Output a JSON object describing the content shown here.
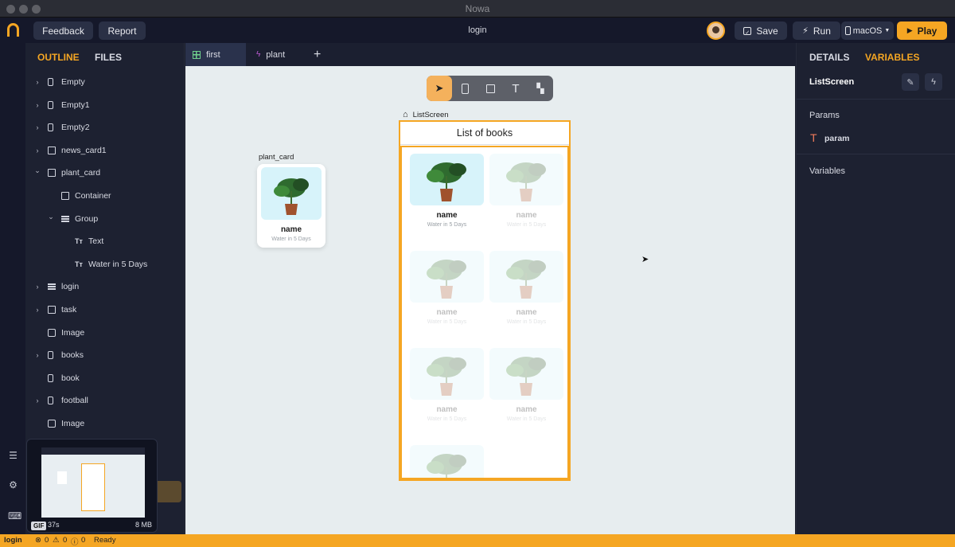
{
  "window": {
    "title": "Nowa"
  },
  "toolbar": {
    "feedback": "Feedback",
    "report": "Report",
    "center_title": "login",
    "save": "Save",
    "run": "Run",
    "platform": "macOS",
    "play": "Play"
  },
  "left_panel": {
    "tabs": [
      "OUTLINE",
      "FILES"
    ],
    "items": [
      {
        "label": "Empty",
        "icon": "phone-icon",
        "chevron": "right",
        "depth": 0
      },
      {
        "label": "Empty1",
        "icon": "phone-icon",
        "chevron": "right",
        "depth": 0
      },
      {
        "label": "Empty2",
        "icon": "phone-icon",
        "chevron": "right",
        "depth": 0
      },
      {
        "label": "news_card1",
        "icon": "box-icon",
        "chevron": "right",
        "depth": 0
      },
      {
        "label": "plant_card",
        "icon": "box-icon",
        "chevron": "down",
        "depth": 0
      },
      {
        "label": "Container",
        "icon": "box-icon",
        "chevron": "",
        "depth": 1
      },
      {
        "label": "Group",
        "icon": "list-icon",
        "chevron": "down",
        "depth": 1
      },
      {
        "label": "Text",
        "icon": "text-icon",
        "chevron": "",
        "depth": 2
      },
      {
        "label": "Water in 5 Days",
        "icon": "text-icon",
        "chevron": "",
        "depth": 2
      },
      {
        "label": "login",
        "icon": "list-icon",
        "chevron": "right",
        "depth": 0
      },
      {
        "label": "task",
        "icon": "box-icon",
        "chevron": "right",
        "depth": 0
      },
      {
        "label": "Image",
        "icon": "image-icon",
        "chevron": "",
        "depth": 0
      },
      {
        "label": "books",
        "icon": "phone-icon",
        "chevron": "right",
        "depth": 0
      },
      {
        "label": "book",
        "icon": "phone-icon",
        "chevron": "",
        "depth": 0
      },
      {
        "label": "football",
        "icon": "phone-icon",
        "chevron": "right",
        "depth": 0
      },
      {
        "label": "Image",
        "icon": "image-icon",
        "chevron": "",
        "depth": 0
      }
    ],
    "gif": {
      "badge": "GIF",
      "duration": "37s",
      "size": "8 MB"
    }
  },
  "editor_tabs": [
    {
      "label": "first",
      "icon": "grid-icon",
      "active": true
    },
    {
      "label": "plant",
      "icon": "bolt-icon",
      "active": false
    }
  ],
  "canvas": {
    "plant_card_label": "plant_card",
    "screen_label": "ListScreen",
    "app_title": "List of books",
    "card_name": "name",
    "card_subtitle": "Water in 5 Days"
  },
  "right_panel": {
    "tabs": [
      "DETAILS",
      "VARIABLES"
    ],
    "screen_name": "ListScreen",
    "params_title": "Params",
    "param": "param",
    "variables_title": "Variables"
  },
  "status": {
    "branch": "login",
    "errors": "0",
    "warnings": "0",
    "infos": "0",
    "state": "Ready"
  },
  "colors": {
    "accent": "#f5a623",
    "panel": "#1d2131",
    "canvas": "#e7edef"
  }
}
